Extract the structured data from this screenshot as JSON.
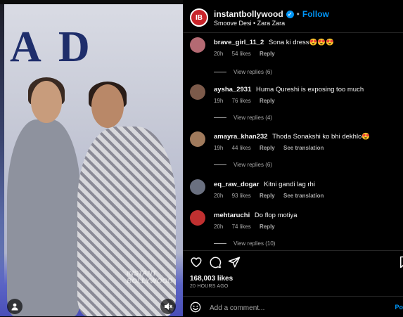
{
  "post": {
    "author": "instantbollywood",
    "follow_label": "Follow",
    "separator": "•",
    "audio": "Smoove Desi • Zara Zara",
    "watermark": "INSTANT BOLLYWOOD"
  },
  "comments": [
    {
      "user": "brave_girl_11_2",
      "text": "Sona ki dress😍😍😍",
      "time": "20h",
      "likes": "54 likes",
      "reply": "Reply",
      "translation": "",
      "view_replies": "View replies (6)",
      "avatar_color": "#b46a73"
    },
    {
      "user": "aysha_2931",
      "text": "Huma Qureshi is exposing too much",
      "time": "19h",
      "likes": "76 likes",
      "reply": "Reply",
      "translation": "",
      "view_replies": "View replies (4)",
      "avatar_color": "#7c5a4a"
    },
    {
      "user": "amayra_khan232",
      "text": "Thoda Sonakshi ko bhi dekhlo😍",
      "time": "19h",
      "likes": "44 likes",
      "reply": "Reply",
      "translation": "See translation",
      "view_replies": "View replies (6)",
      "avatar_color": "#a07a5c"
    },
    {
      "user": "eq_raw_dogar",
      "text": "Kitni gandi lag rhi",
      "time": "20h",
      "likes": "93 likes",
      "reply": "Reply",
      "translation": "See translation",
      "view_replies": "",
      "avatar_color": "#6a7080"
    },
    {
      "user": "mehtaruchi",
      "text": "Do flop motiya",
      "time": "20h",
      "likes": "74 likes",
      "reply": "Reply",
      "translation": "",
      "view_replies": "View replies (10)",
      "avatar_color": "#c03030"
    }
  ],
  "footer": {
    "likes": "168,003 likes",
    "time": "20 HOURS AGO",
    "comment_placeholder": "Add a comment...",
    "post_label": "Po"
  },
  "icons": [
    "heart-icon",
    "comment-icon",
    "share-icon",
    "save-icon",
    "emoji-icon",
    "user-tag-icon",
    "mute-icon",
    "verified-icon"
  ],
  "colors": {
    "accent": "#0095f6",
    "background": "#000000",
    "muted": "#a8a8a8"
  }
}
